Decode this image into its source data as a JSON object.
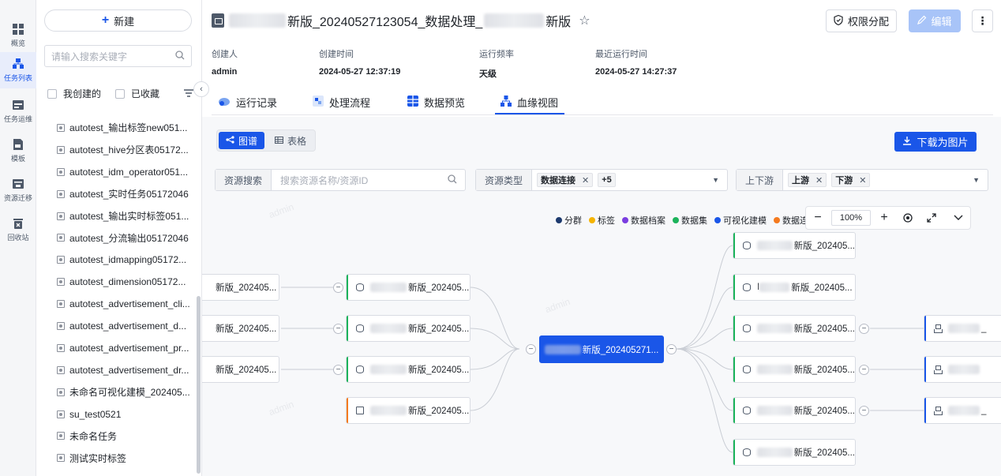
{
  "rail": {
    "items": [
      {
        "label": "概览",
        "icon": "grid-icon"
      },
      {
        "label": "任务列表",
        "icon": "tasklist-icon"
      },
      {
        "label": "任务运维",
        "icon": "ops-icon"
      },
      {
        "label": "模板",
        "icon": "template-icon"
      },
      {
        "label": "资源迁移",
        "icon": "migrate-icon"
      },
      {
        "label": "回收站",
        "icon": "trash-icon"
      }
    ]
  },
  "panel": {
    "new_label": "新建",
    "search_placeholder": "请输入搜索关键字",
    "filter_mine": "我创建的",
    "filter_fav": "已收藏",
    "tasks": [
      "autotest_输出标签new051...",
      "autotest_hive分区表05172...",
      "autotest_idm_operator051...",
      "autotest_实时任务05172046",
      "autotest_输出实时标签051...",
      "autotest_分流输出05172046",
      "autotest_idmapping05172...",
      "autotest_dimension05172...",
      "autotest_advertisement_cli...",
      "autotest_advertisement_d...",
      "autotest_advertisement_pr...",
      "autotest_advertisement_dr...",
      "未命名可视化建模_202405...",
      "su_test0521",
      "未命名任务",
      "测试实时标签"
    ]
  },
  "header": {
    "title_mid": "新版_20240527123054_数据处理_",
    "title_end": "新版",
    "perm_label": "权限分配",
    "edit_label": "编辑",
    "meta": [
      {
        "label": "创建人",
        "value": "admin"
      },
      {
        "label": "创建时间",
        "value": "2024-05-27 12:37:19"
      },
      {
        "label": "运行频率",
        "value": "天级"
      },
      {
        "label": "最近运行时间",
        "value": "2024-05-27 14:27:37"
      }
    ]
  },
  "tabs": [
    "运行记录",
    "处理流程",
    "数据预览",
    "血缘视图"
  ],
  "lineage": {
    "view_graph": "图谱",
    "view_table": "表格",
    "download_label": "下载为图片",
    "res_search_label": "资源搜索",
    "res_search_placeholder": "搜索资源名称/资源ID",
    "res_type_label": "资源类型",
    "res_type_chip": "数据连接",
    "res_type_more": "+5",
    "updown_label": "上下游",
    "chip_up": "上游",
    "chip_down": "下游",
    "legend": [
      {
        "label": "分群",
        "color": "#1d3a6e"
      },
      {
        "label": "标签",
        "color": "#f5b400"
      },
      {
        "label": "数据档案",
        "color": "#7a3de0"
      },
      {
        "label": "数据集",
        "color": "#1cb35b"
      },
      {
        "label": "可视化建模",
        "color": "#1a56e8"
      },
      {
        "label": "数据连接",
        "color": "#f47a1f"
      }
    ],
    "zoom": "100%",
    "watermark": "admin",
    "center_node": "新版_202405271...",
    "far_left": [
      "新版_202405...",
      "新版_202405...",
      "新版_202405..."
    ],
    "left_nodes": [
      "新版_202405...",
      "新版_202405...",
      "新版_202405...",
      "新版_202405..."
    ],
    "right_nodes": [
      "新版_202405...",
      "新版_202405...",
      "新版_202405...",
      "新版_202405...",
      "新版_202405...",
      "新版_202405..."
    ],
    "right_node_b_prefix": "I",
    "far_right_suffix": "_",
    "far_right_suffix2": "_"
  }
}
